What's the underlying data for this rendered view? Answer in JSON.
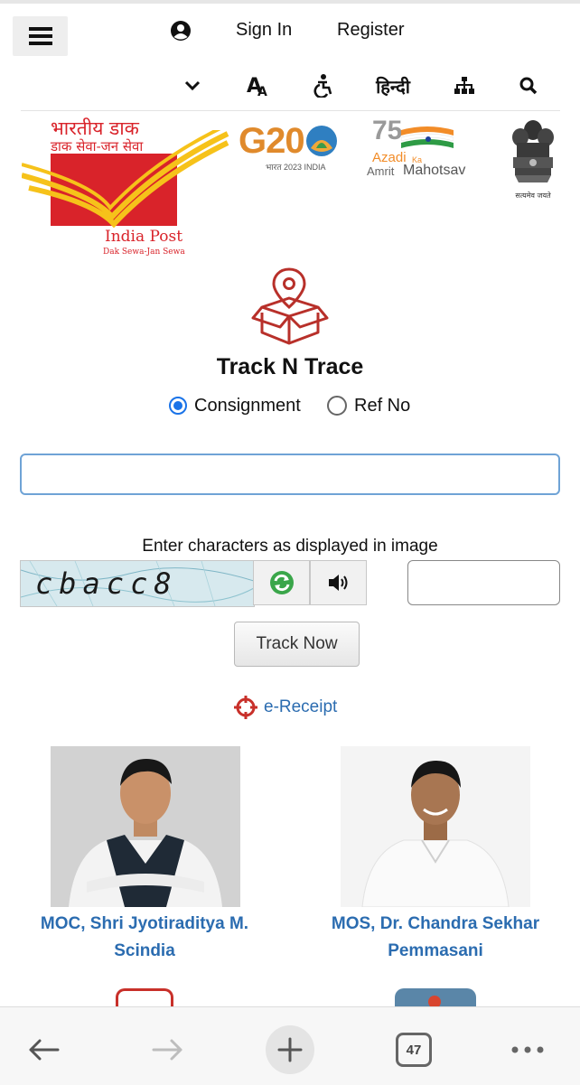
{
  "header": {
    "menu_icon": "hamburger-menu-icon",
    "account_icon": "user-circle-icon",
    "sign_in": "Sign In",
    "register": "Register",
    "tools": {
      "chevron": "chevron-down-icon",
      "text_size": "text-size-icon",
      "accessibility": "accessibility-icon",
      "language": "हिन्दी",
      "sitemap": "sitemap-icon",
      "search": "search-icon"
    }
  },
  "logos": {
    "india_post": {
      "hindi_title": "भारतीय डाक",
      "hindi_tagline": "डाक सेवा-जन सेवा",
      "name": "India Post",
      "tagline": "Dak Sewa-Jan Sewa"
    },
    "g20": {
      "text": "G20",
      "subtext": "भारत 2023 INDIA"
    },
    "azadi": {
      "number": "75",
      "line1": "Azadi",
      "ka": "Ka",
      "line2": "Amrit",
      "line3": "Mahotsav"
    },
    "emblem": {
      "motto": "सत्यमेव जयते"
    }
  },
  "track": {
    "icon": "parcel-location-icon",
    "title": "Track N Trace",
    "options": [
      {
        "label": "Consignment",
        "selected": true
      },
      {
        "label": "Ref No",
        "selected": false
      }
    ],
    "input_value": "",
    "captcha_label": "Enter characters as displayed in image",
    "captcha_text": "cbacc8",
    "captcha_refresh_icon": "refresh-icon",
    "captcha_audio_icon": "speaker-icon",
    "captcha_input_value": "",
    "button": "Track Now"
  },
  "ereceipt": {
    "icon": "crosshair-icon",
    "label": "e-Receipt"
  },
  "ministers": [
    {
      "line1": "MOC, Shri Jyotiraditya M.",
      "line2": "Scindia"
    },
    {
      "line1": "MOS, Dr. Chandra Sekhar",
      "line2": "Pemmasani"
    }
  ],
  "bottom_bar": {
    "back_icon": "back-arrow-icon",
    "forward_icon": "forward-arrow-icon",
    "new_tab_icon": "plus-icon",
    "tab_count": "47",
    "more_icon": "more-dots-icon"
  },
  "colors": {
    "india_post_red": "#d9232a",
    "india_post_yellow": "#f6c21a",
    "link_blue": "#2b6cb0",
    "radio_blue": "#1a73e8",
    "icon_red": "#b8302a"
  }
}
